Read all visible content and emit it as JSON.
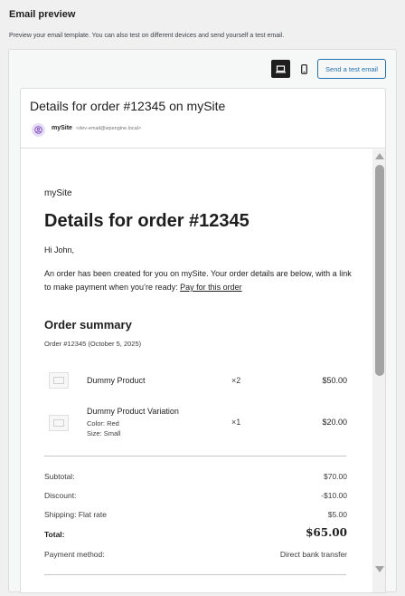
{
  "panel": {
    "title": "Email preview",
    "description": "Preview your email template. You can also test on different devices and send yourself a test email."
  },
  "toolbar": {
    "desktop_icon": "laptop-icon",
    "mobile_icon": "smartphone-icon",
    "send_test_label": "Send a test email",
    "accent": "#2271b1"
  },
  "header": {
    "subject": "Details for order #12345 on mySite",
    "from_name": "mySite",
    "from_email": "<dev-email@wpengine.local>",
    "avatar_icon": "user-icon"
  },
  "email": {
    "site_name": "mySite",
    "heading": "Details for order #12345",
    "greeting": "Hi John,",
    "intro": "An order has been created for you on mySite. Your order details are below, with a link to make payment when you’re ready: ",
    "pay_link": "Pay for this order",
    "summary_title": "Order summary",
    "summary_meta": "Order #12345 (October 5, 2025)",
    "items": [
      {
        "name": "Dummy Product",
        "meta1": "",
        "meta2": "",
        "qty": "×2",
        "price": "$50.00"
      },
      {
        "name": "Dummy Product Variation",
        "meta1": "Color: Red",
        "meta2": "Size: Small",
        "qty": "×1",
        "price": "$20.00"
      }
    ],
    "totals": [
      {
        "label": "Subtotal:",
        "value": "$70.00"
      },
      {
        "label": "Discount:",
        "value": "-$10.00"
      },
      {
        "label": "Shipping: Flat rate",
        "value": "$5.00"
      },
      {
        "label": "Total:",
        "value": "$65.00"
      },
      {
        "label": "Payment method:",
        "value": "Direct bank transfer"
      }
    ]
  }
}
